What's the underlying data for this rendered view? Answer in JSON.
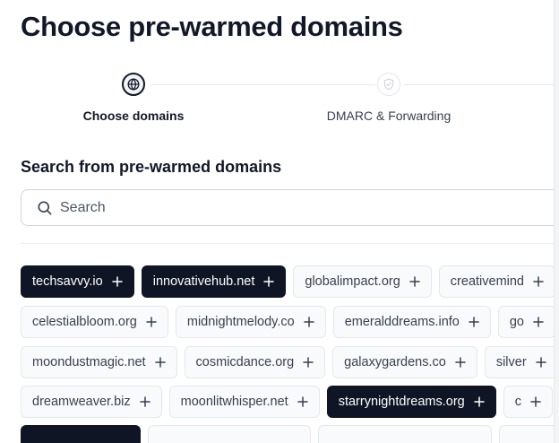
{
  "page": {
    "title": "Choose pre-warmed domains"
  },
  "stepper": {
    "steps": [
      {
        "label": "Choose domains",
        "icon": "globe-icon",
        "state": "active"
      },
      {
        "label": "DMARC & Forwarding",
        "icon": "shield-check-icon",
        "state": "inactive"
      }
    ]
  },
  "search": {
    "section_title": "Search from pre-warmed domains",
    "placeholder": "Search",
    "value": ""
  },
  "domains": {
    "rows": [
      [
        {
          "name": "techsavvy.io",
          "selected": true
        },
        {
          "name": "innovativehub.net",
          "selected": true
        },
        {
          "name": "globalimpact.org",
          "selected": false
        },
        {
          "name": "creativemind",
          "selected": false
        }
      ],
      [
        {
          "name": "celestialbloom.org",
          "selected": false
        },
        {
          "name": "midnightmelody.co",
          "selected": false
        },
        {
          "name": "emeralddreams.info",
          "selected": false
        },
        {
          "name": "go",
          "selected": false
        }
      ],
      [
        {
          "name": "moondustmagic.net",
          "selected": false
        },
        {
          "name": "cosmicdance.org",
          "selected": false
        },
        {
          "name": "galaxygardens.co",
          "selected": false
        },
        {
          "name": "silver",
          "selected": false
        }
      ],
      [
        {
          "name": "dreamweaver.biz",
          "selected": false
        },
        {
          "name": "moonlitwhisper.net",
          "selected": false
        },
        {
          "name": "starrynightdreams.org",
          "selected": true
        },
        {
          "name": "c",
          "selected": false
        }
      ],
      [
        {
          "name": "",
          "selected": true
        },
        {
          "name": "",
          "selected": false
        },
        {
          "name": "",
          "selected": false
        },
        {
          "name": "",
          "selected": false
        }
      ]
    ]
  },
  "colors": {
    "selected_chip_bg": "#0f1524",
    "chip_bg": "#f9fafb",
    "chip_border": "#e5e7eb",
    "text_primary": "#111827"
  }
}
